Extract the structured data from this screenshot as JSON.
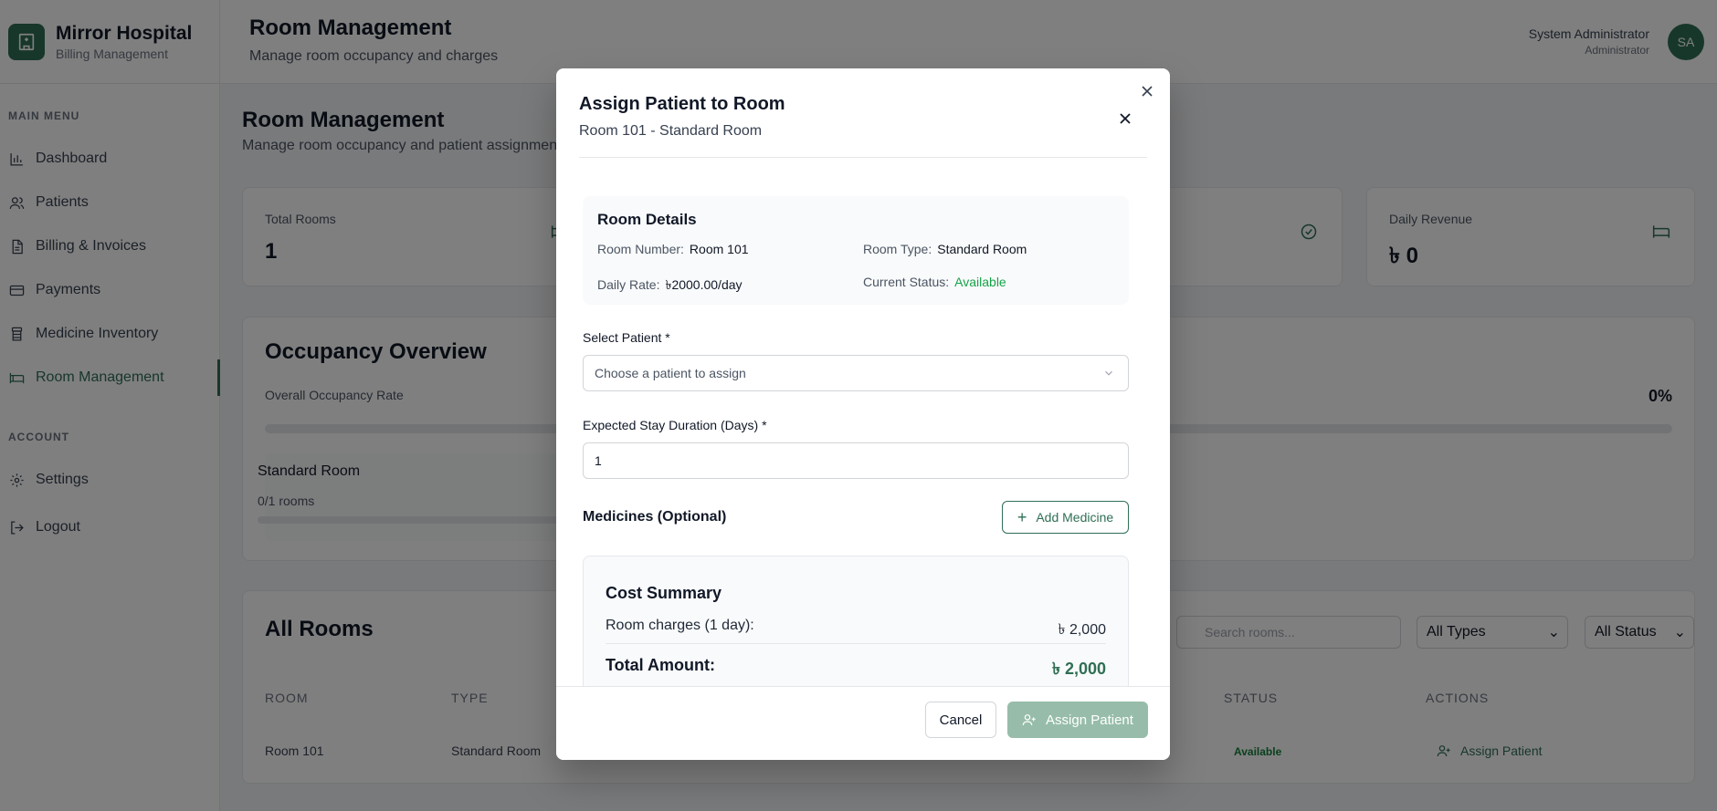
{
  "brand": {
    "title": "Mirror Hospital",
    "subtitle": "Billing Management"
  },
  "sidebar": {
    "main_heading": "MAIN MENU",
    "items": [
      {
        "label": "Dashboard",
        "icon": "chart-icon"
      },
      {
        "label": "Patients",
        "icon": "users-icon"
      },
      {
        "label": "Billing & Invoices",
        "icon": "file-icon"
      },
      {
        "label": "Payments",
        "icon": "credit-card-icon"
      },
      {
        "label": "Medicine Inventory",
        "icon": "pill-bottle-icon"
      },
      {
        "label": "Room Management",
        "icon": "bed-icon",
        "active": true
      }
    ],
    "account_heading": "ACCOUNT",
    "account_items": [
      {
        "label": "Settings",
        "icon": "gear-icon"
      },
      {
        "label": "Logout",
        "icon": "logout-icon"
      }
    ]
  },
  "header": {
    "title": "Room Management",
    "subtitle": "Manage room occupancy and charges",
    "user_name": "System Administrator",
    "user_role": "Administrator",
    "avatar": "SA"
  },
  "page": {
    "title": "Room Management",
    "subtitle": "Manage room occupancy and patient assignments"
  },
  "stats": [
    {
      "label": "Total Rooms",
      "value": "1",
      "icon": "bed-icon"
    },
    {
      "label": "Daily Revenue",
      "value": "৳ 0",
      "icon": "bed-icon"
    }
  ],
  "occupancy": {
    "title": "Occupancy Overview",
    "label": "Overall Occupancy Rate",
    "percent": "0%",
    "room_type": "Standard Room",
    "room_count": "0/1 rooms"
  },
  "all_rooms": {
    "title": "All Rooms",
    "search_placeholder": "Search rooms...",
    "type_filter": "All Types",
    "status_filter": "All Status",
    "headers": [
      "ROOM",
      "TYPE",
      "STATUS",
      "ACTIONS"
    ],
    "row": {
      "room": "Room 101",
      "type": "Standard Room",
      "status": "Available",
      "action": "Assign Patient"
    }
  },
  "modal": {
    "title": "Assign Patient to Room",
    "subtitle": "Room 101 - Standard Room",
    "details_heading": "Room Details",
    "room_number_label": "Room Number:",
    "room_number": "Room 101",
    "room_type_label": "Room Type:",
    "room_type": "Standard Room",
    "daily_rate_label": "Daily Rate:",
    "daily_rate": "৳2000.00/day",
    "status_label": "Current Status:",
    "status": "Available",
    "select_patient_label": "Select Patient *",
    "select_patient_placeholder": "Choose a patient to assign",
    "duration_label": "Expected Stay Duration (Days) *",
    "duration_value": "1",
    "medicines_heading": "Medicines (Optional)",
    "add_medicine": "Add Medicine",
    "cost_heading": "Cost Summary",
    "room_charges_label": "Room charges (1 day):",
    "room_charges_value": "৳ 2,000",
    "total_label": "Total Amount:",
    "total_value": "৳ 2,000",
    "cancel": "Cancel",
    "assign": "Assign Patient"
  },
  "colors": {
    "brand": "#2f6f54",
    "available": "#16a34a",
    "assign_disabled": "#97bdaa"
  }
}
